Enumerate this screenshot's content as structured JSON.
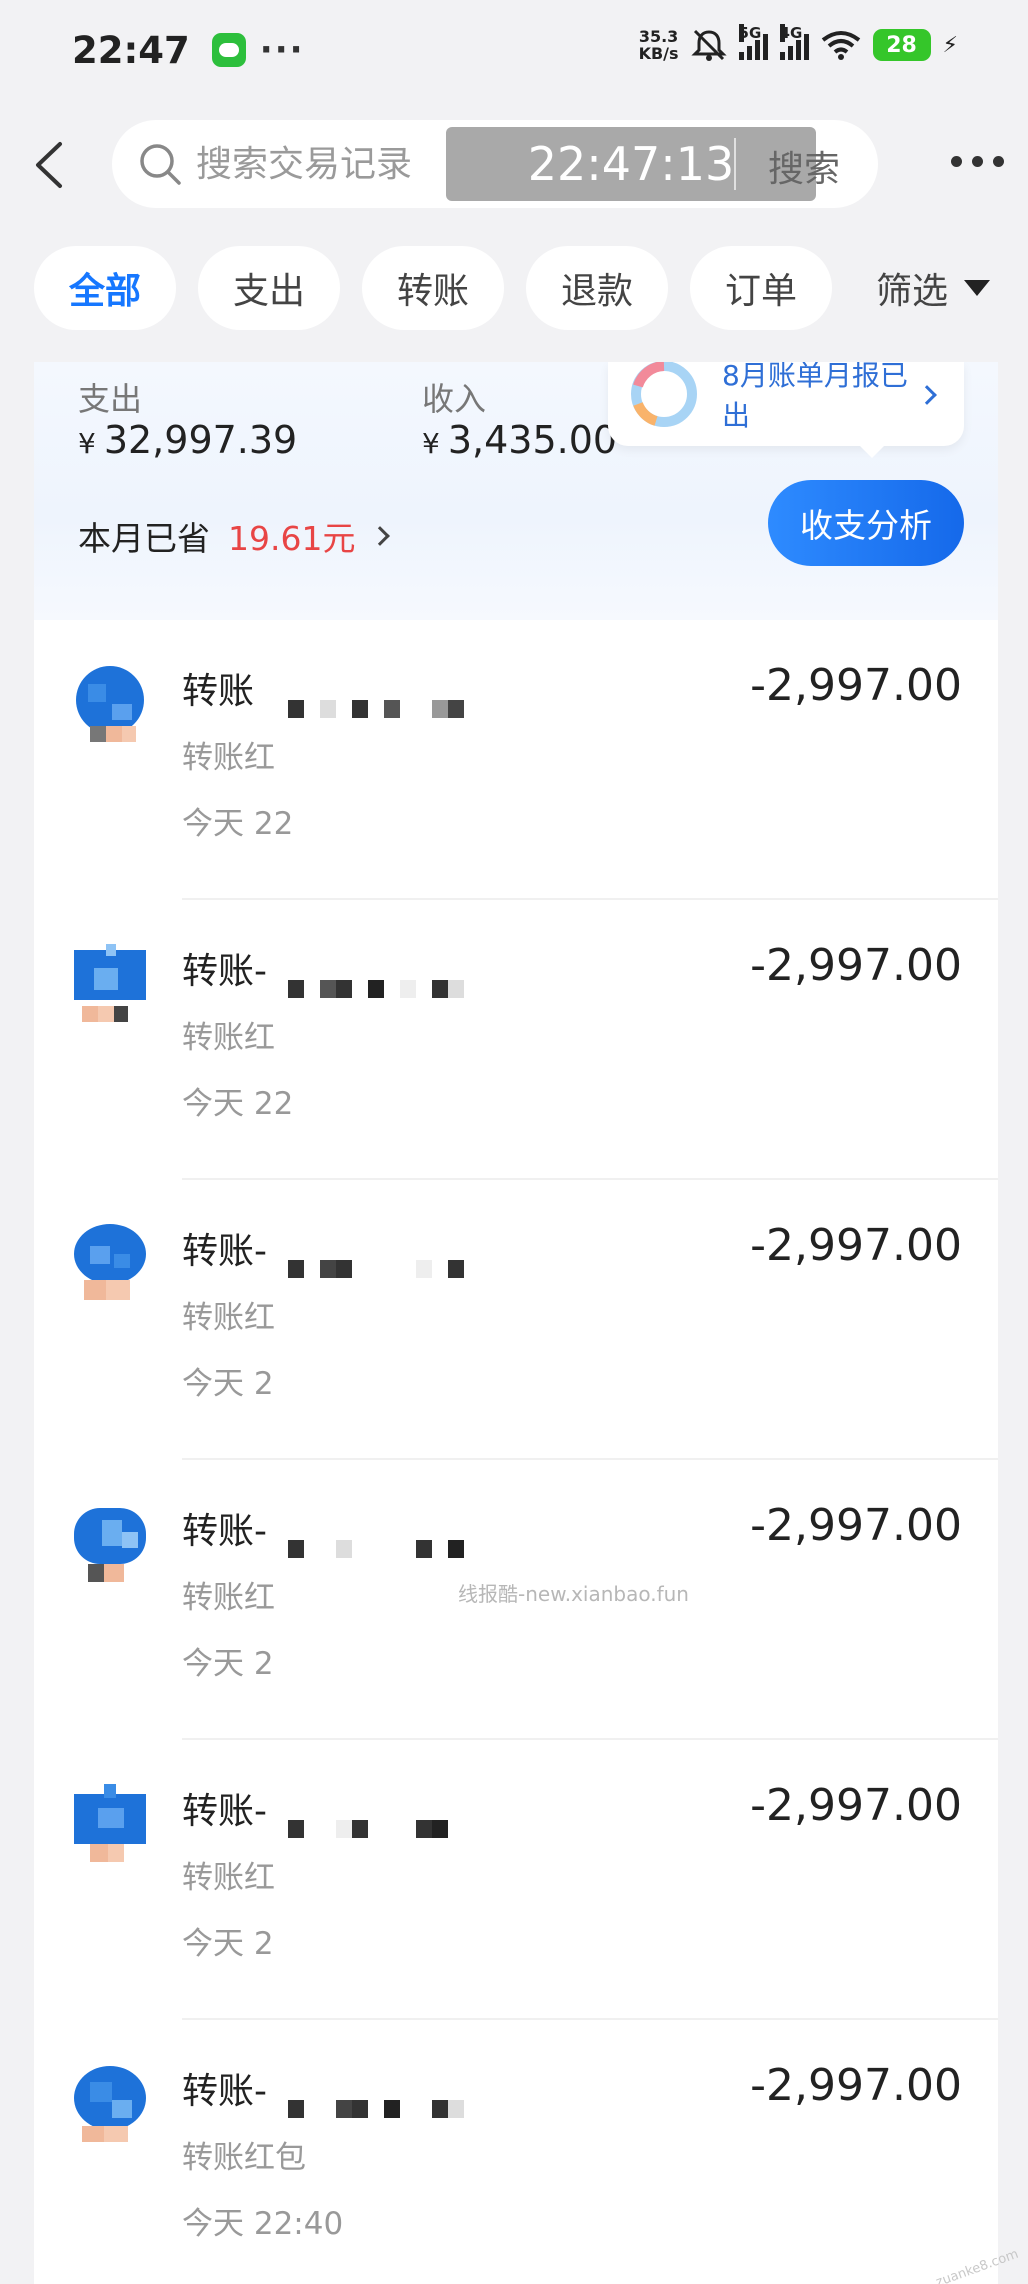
{
  "status_bar": {
    "time": "22:47",
    "dots": "···",
    "net_speed_value": "35.3",
    "net_speed_unit": "KB/s",
    "sig1_label": "5G",
    "sig2_label": "4G",
    "battery": "28"
  },
  "header": {
    "search_placeholder": "搜索交易记录",
    "time_overlay": "22:47:13",
    "search_button": "搜索"
  },
  "tabs": [
    "全部",
    "支出",
    "转账",
    "退款",
    "订单"
  ],
  "filter_label": "筛选",
  "summary": {
    "expense_label": "支出",
    "expense_currency": "¥",
    "expense_value": "32,997.39",
    "income_label": "收入",
    "income_currency": "¥",
    "income_value": "3,435.00",
    "saved_label": "本月已省",
    "saved_amount": "19.61元",
    "report_text": "8月账单月报已出",
    "analysis_button": "收支分析"
  },
  "transactions": [
    {
      "title": "转账",
      "subtitle": "转账红",
      "time": "今天 22",
      "amount": "-2,997.00"
    },
    {
      "title": "转账-",
      "subtitle": "转账红",
      "time": "今天 22",
      "amount": "-2,997.00"
    },
    {
      "title": "转账-",
      "subtitle": "转账红",
      "time": "今天 2",
      "amount": "-2,997.00"
    },
    {
      "title": "转账-",
      "subtitle": "转账红",
      "time": "今天 2",
      "amount": "-2,997.00"
    },
    {
      "title": "转账-",
      "subtitle": "转账红",
      "time": "今天 2",
      "amount": "-2,997.00"
    },
    {
      "title": "转账-",
      "subtitle": "转账红包",
      "time": "今天 22:40",
      "amount": "-2,997.00"
    }
  ],
  "watermark": "线报酷-new.xianbao.fun",
  "corner_watermark": "zuanke8.com",
  "colors": {
    "accent": "#1677ff",
    "saved_red": "#e84545",
    "avatar_blue": "#1e72d9",
    "background": "#f2f2f4"
  }
}
